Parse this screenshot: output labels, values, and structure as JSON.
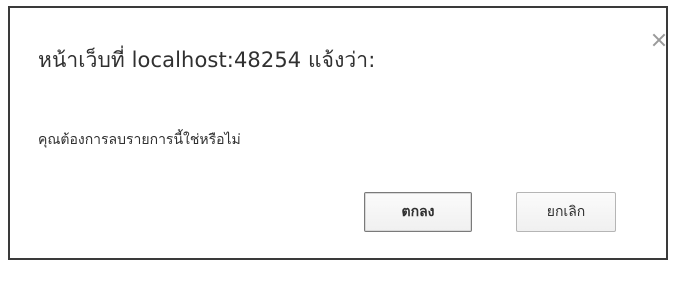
{
  "dialog": {
    "title": "หน้าเว็บที่ localhost:48254 แจ้งว่า:",
    "message": "คุณต้องการลบรายการนี้ใช่หรือไม่",
    "ok_label": "ตกลง",
    "cancel_label": "ยกเลิก",
    "close_icon": "close-icon"
  }
}
